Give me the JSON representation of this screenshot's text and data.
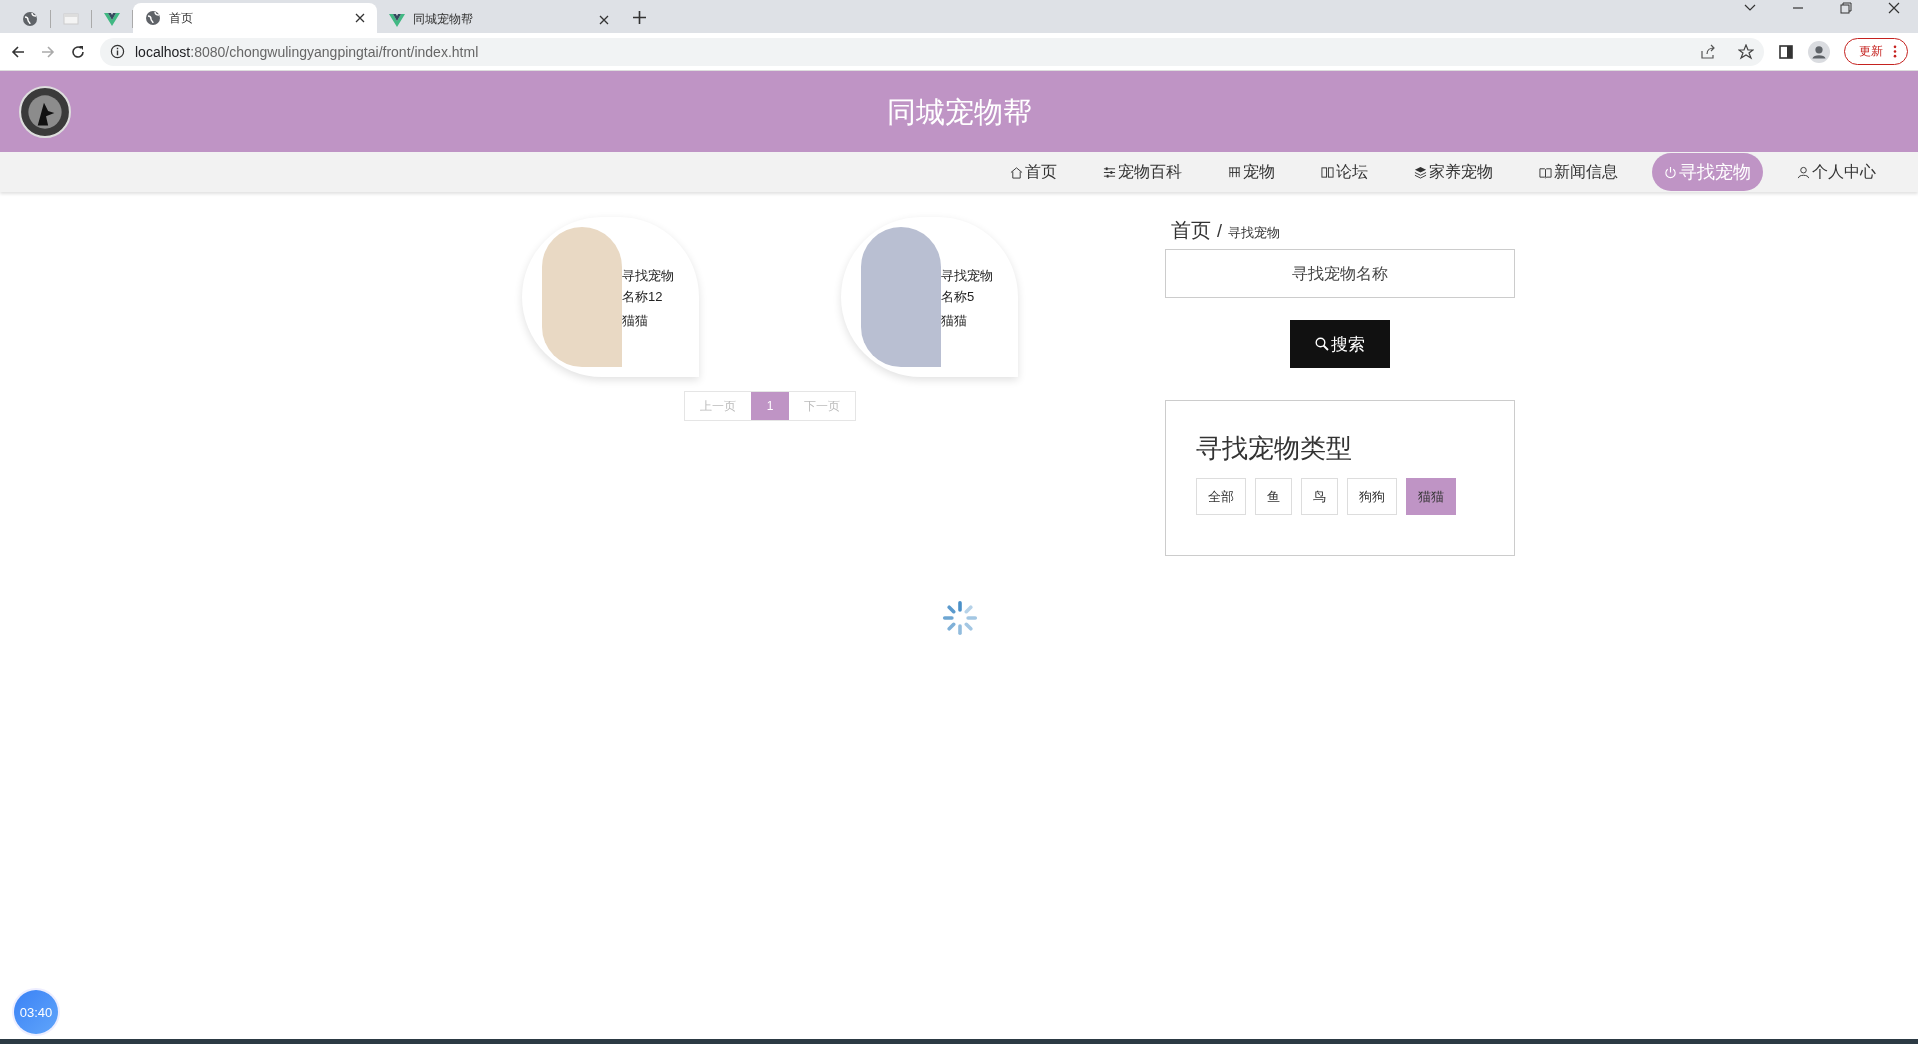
{
  "browser": {
    "tabs": [
      {
        "kind": "globe",
        "selected": false
      },
      {
        "kind": "blank",
        "selected": false
      },
      {
        "kind": "vue",
        "selected": false
      },
      {
        "kind": "globe",
        "title": "首页",
        "selected": true
      },
      {
        "kind": "vue",
        "title": "同城宠物帮",
        "selected": false
      }
    ],
    "address": {
      "host": "localhost",
      "rest": ":8080/chongwulingyangpingtai/front/index.html"
    },
    "update_button": "更新"
  },
  "site": {
    "title": "同城宠物帮",
    "nav": [
      {
        "kind": "home",
        "label": "首页",
        "selected": false
      },
      {
        "kind": "sliders",
        "label": "宠物百科",
        "selected": false
      },
      {
        "kind": "grid",
        "label": "宠物",
        "selected": false
      },
      {
        "kind": "chat",
        "label": "论坛",
        "selected": false
      },
      {
        "kind": "layers",
        "label": "家养宠物",
        "selected": false
      },
      {
        "kind": "book",
        "label": "新闻信息",
        "selected": false
      },
      {
        "kind": "power",
        "label": "寻找宠物",
        "selected": true
      },
      {
        "kind": "user",
        "label": "个人中心",
        "selected": false
      }
    ],
    "cards": [
      {
        "name": "寻找宠物名称12",
        "type": "猫猫",
        "color": "#e9d9c4"
      },
      {
        "name": "寻找宠物名称5",
        "type": "猫猫",
        "color": "#b9bfd2"
      }
    ],
    "pagination": {
      "prev": "上一页",
      "pages": [
        {
          "label": "1",
          "selected": true
        }
      ],
      "next": "下一页"
    },
    "breadcrumb": {
      "home": "首页",
      "separator": "/",
      "current": "寻找宠物"
    },
    "search": {
      "placeholder": "寻找宠物名称",
      "button": "搜索"
    },
    "categories": {
      "title": "寻找宠物类型",
      "items": [
        {
          "label": "全部",
          "selected": false
        },
        {
          "label": "鱼",
          "selected": false
        },
        {
          "label": "鸟",
          "selected": false
        },
        {
          "label": "狗狗",
          "selected": false
        },
        {
          "label": "猫猫",
          "selected": true
        }
      ]
    },
    "timer": "03:40"
  }
}
